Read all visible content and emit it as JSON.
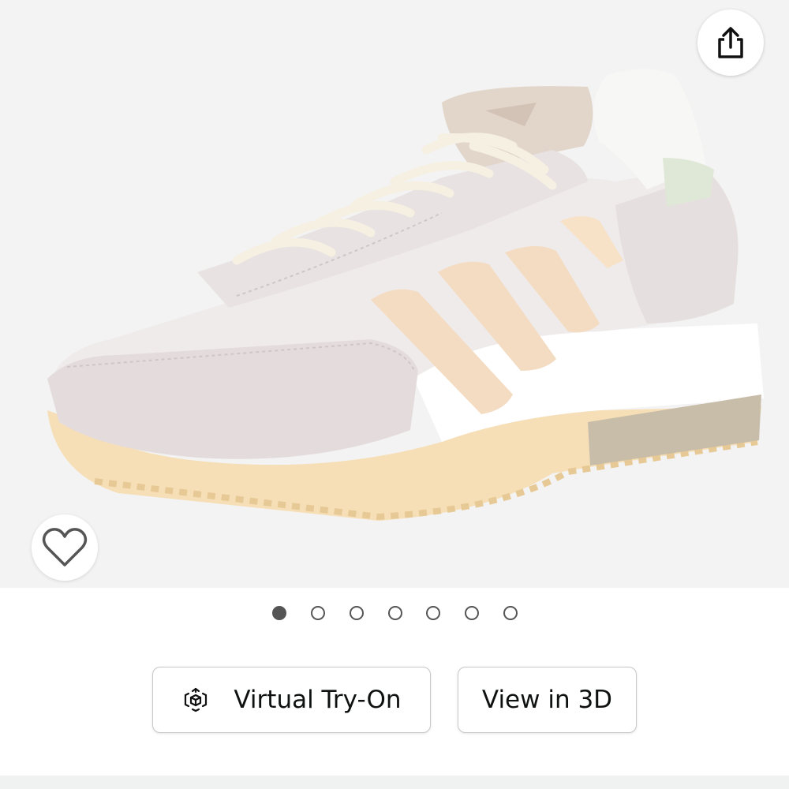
{
  "product": {
    "image_alt": "",
    "image_count": 7,
    "active_image_index": 0
  },
  "actions": {
    "share_icon": "share-icon",
    "favorite_icon": "heart-icon",
    "virtual_tryon_label": "Virtual Try-On",
    "virtual_tryon_icon": "ar-cube-icon",
    "view_3d_label": "View in 3D"
  },
  "colors": {
    "image_background": "#f3f3f3",
    "dot_color": "#555555",
    "button_border": "#c8c8c8",
    "text": "#0f1111"
  }
}
